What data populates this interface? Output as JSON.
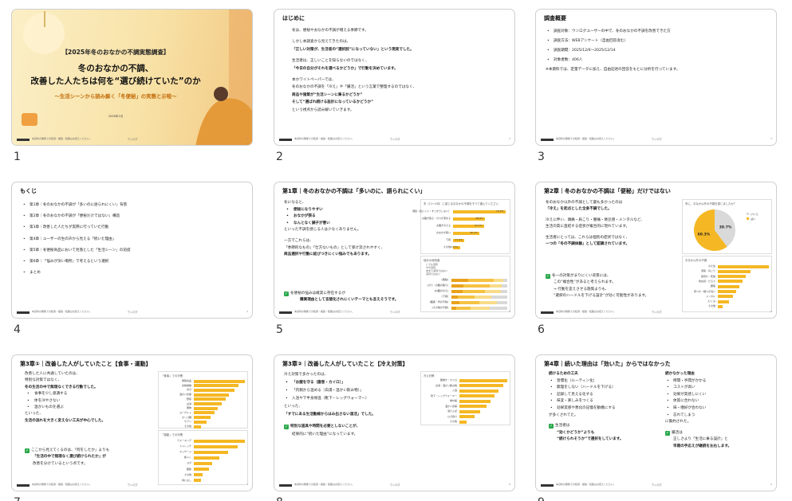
{
  "page_numbers": [
    "1",
    "2",
    "3",
    "4",
    "5",
    "6",
    "7",
    "8",
    "9"
  ],
  "footer": {
    "text": "本資料の無断での転用・複製・転載はお控えください。",
    "brand": "ウンログ",
    "page_nums": [
      "1",
      "2",
      "3",
      "4",
      "5",
      "6",
      "7",
      "8",
      "9"
    ]
  },
  "colors": {
    "accent": "#f5b824",
    "grey": "#d9d9d9",
    "green": "#2aa84a"
  },
  "slide1": {
    "tag": "【2025年冬のおなかの不調実態調査】",
    "title_line1": "冬のおなかの不調、",
    "title_line2": "改善した人たちは何を“選び続けていた”のか",
    "subtitle": "〜生活シーンから読み解く「冬便秘」の実態と示唆〜",
    "date": "2026年1月"
  },
  "slide2": {
    "title": "はじめに",
    "lines": [
      {
        "t": "冬は、便秘やおなかの不調が増える季節です。",
        "b": false
      },
      {
        "t": "",
        "b": false
      },
      {
        "t": "しかし本調査から見えてきたのは、",
        "b": false
      },
      {
        "t": "「正しい対策が、生活者の“選択肢”になっていない」という現実でした。",
        "b": true
      },
      {
        "t": "",
        "b": false
      },
      {
        "t": "生活者は、正しいことを知らないのではなく、",
        "b": false
      },
      {
        "t": "「今日の自分がそれを選べるかどうか」で行動を決めています。",
        "b": true
      },
      {
        "t": "",
        "b": false
      },
      {
        "t": "本ホワイトペーパーでは、",
        "b": false
      },
      {
        "t": "冬のおなかの不調を「冷え」や「腸活」という言葉で整理するのではなく、",
        "b": false
      },
      {
        "t": "商品や施策が“生活シーンに乗るかどうか”",
        "b": true
      },
      {
        "t": "そして“選ばれ続ける設計になっているかどうか”",
        "b": true
      },
      {
        "t": "という視点から読み解いていきます。",
        "b": false
      }
    ]
  },
  "slide3": {
    "title": "調査概要",
    "items": [
      "調査対象：ウンログユーザーの中で、冬のおなかの不調を改善できた方",
      "調査方法：WEBアンケート（自由回答含む）",
      "調査期間：2025/12/6〜2025/12/14",
      "対象者数：406人"
    ],
    "note": "※本資料では、定量データに加え、自由記述の回答をもとに分析を行っています。"
  },
  "slide4": {
    "title": "もくじ",
    "items": [
      "第1章｜冬のおなかの不調が「多いのに語られにくい」背景",
      "第2章｜冬のおなかの不調が「便秘だけではない」構造",
      "第3章｜改善した人たちが実際に行っていた行動",
      "第4章｜ユーザーの生の声から見える「続いた理由」",
      "第5章｜冬便秘商品において見落とした「生活シーン」の前提",
      "第6章｜「悩みが深い場所」で考えるという選択",
      "まとめ"
    ]
  },
  "slide5": {
    "title": "第1章｜冬のおなかの不調は「多いのに、語られにくい」",
    "lines": [
      {
        "t": "冬になると、",
        "b": false,
        "li": false
      },
      {
        "t": "便秘になりやすい",
        "b": true,
        "li": true
      },
      {
        "t": "おなかが張る",
        "b": true,
        "li": true
      },
      {
        "t": "なんとなく調子が悪い",
        "b": true,
        "li": true
      },
      {
        "t": "といった不調を感じる人は少なくありません。",
        "b": false,
        "li": false
      },
      {
        "t": "",
        "b": false,
        "li": false
      },
      {
        "t": "一方でこれらは、",
        "b": false,
        "li": false
      },
      {
        "t": "「季節的なもの」「仕方ないもの」として受け流されやすく、",
        "b": false,
        "li": false
      },
      {
        "t": "商品選択や行動に結びつきにくい悩みでもあります。",
        "b": true,
        "li": false
      }
    ],
    "callout_l1": "冬便秘の悩みは確実に存在するが",
    "callout_l2": "購買理由として言語化されにくいテーマとも言えそうです。"
  },
  "slide6": {
    "title": "第2章｜冬のおなかの不調は「便秘」だけではない",
    "lines": [
      {
        "t": "冬のおなか以外の不調として最も多かったのは",
        "b": false
      },
      {
        "t": "「冷え」を起点とした全身不調でした。",
        "b": true
      },
      {
        "t": "",
        "b": false
      },
      {
        "t": "冷えに伴い、頭痛・肩こり・腰痛・倦怠感・メンタルなど、",
        "b": false
      },
      {
        "t": "生活の質に直結する症状が複合的に現れています。",
        "b": false
      },
      {
        "t": "",
        "b": false
      },
      {
        "t": "生活者にとっては、これらは個別の症状ではなく、",
        "b": false
      },
      {
        "t": "一つの「冬の不調体験」として認識されています。",
        "b": true
      }
    ],
    "callout": [
      "冬一の対策がまりにくい背景には、",
      "この“複合性”があると考えられます。",
      "→ 行動を変えさせる施策よりも、",
      "“選択のハードルを下げる設計”が効く可能性があります。"
    ]
  },
  "slide7": {
    "title": "第3章①｜改善した人がしていたこと【食事・運動】",
    "lines": [
      {
        "t": "改善した人に共通していたのは、",
        "b": false,
        "li": false
      },
      {
        "t": "特別な対策ではなく、",
        "b": false,
        "li": false
      },
      {
        "t": "冬の生活の中で無理なくできる行動でした。",
        "b": true,
        "li": false
      },
      {
        "t": "食事を少し意識する",
        "b": false,
        "li": true
      },
      {
        "t": "体を冷やさない",
        "b": false,
        "li": true
      },
      {
        "t": "温かいものを選ぶ",
        "b": false,
        "li": true
      },
      {
        "t": "といった、",
        "b": false,
        "li": false
      },
      {
        "t": "生活の流れを大きく変えない工夫が中心でした。",
        "b": true,
        "li": false
      }
    ],
    "callout": [
      "ここから見えてくるのは、「何をしたか」よりも",
      "「生活の中で無理なく選び続けられたか」が",
      "改善を分けているという点です。"
    ]
  },
  "slide8": {
    "title": "第3章②｜改善した人がしていたこと【冷え対策】",
    "lead": "冷え対策で多かったのは、",
    "items": [
      "「お腹を守る（腹巻・カイロ）」",
      "「内側から温める（白湯・温かい飲み物）」",
      "入浴や下半身保温（靴下・レッグウォーマー）"
    ],
    "after": "といった、",
    "bold": "「すでにある生活動線からはみ出さない温活」でした。",
    "callout": [
      "特別な道具や時間を必要としないことが、",
      "結果的に“続いた理由”になっています。"
    ]
  },
  "slide9": {
    "title": "第4章｜続いた理由は「効いた」からではなかった",
    "left_head": "続けるための工夫",
    "left_items": [
      "習慣化（ルーティン化）",
      "無理をしない（ハードルを下げる）",
      "記録して見える化する",
      "味変・楽しみをつくる",
      "効果実感や悪化の記憶を動機にする"
    ],
    "left_after": "が多くされてた。",
    "right_head": "続かなかった理由",
    "right_items": [
      "時間・手間がかかる",
      "コストが高い",
      "効果が実感しにくい",
      "体質に合わない",
      "味・嗜好が合わない",
      "忘れてしまう"
    ],
    "right_after": "に集約された。",
    "callout_left": [
      "生活者は",
      "“効くかどうか”よりも",
      "“続けられそうか”で選択をしています。"
    ],
    "callout_right": [
      "腸活は",
      "正しさより「生活に乗る設計」と",
      "早期の手応えが継続を左右します。"
    ]
  },
  "chart_data": [
    {
      "type": "bar",
      "title": "冬（11〜2月）に感じるおなかの不調をすべて選んでください",
      "categories": [
        "便秘（出にくい・すっきりしない）",
        "お腹が張る・ガスが溜まる",
        "お腹が冷える",
        "おなかが痛い",
        "下痢",
        "その他"
      ],
      "values": [
        79.5,
        48.6,
        47.1,
        40.1,
        17.4,
        10.5
      ]
    },
    {
      "type": "bar",
      "title": "悩みの深刻度",
      "categories": [
        "[便秘]",
        "[ガス・お腹の張り]",
        "[お腹の冷え]",
        "[下痢]",
        "[腹痛・胃の不快]",
        "[その他の不調]"
      ],
      "series": [
        {
          "name": "とても深刻",
          "values": [
            30,
            22,
            20,
            12,
            14,
            8
          ]
        },
        {
          "name": "やや深刻",
          "values": [
            45,
            46,
            40,
            30,
            36,
            26
          ]
        },
        {
          "name": "あまり深刻ではない",
          "values": [
            18,
            22,
            28,
            30,
            32,
            34
          ]
        },
        {
          "name": "深刻ではない",
          "values": [
            7,
            10,
            12,
            28,
            18,
            32
          ]
        }
      ]
    },
    {
      "type": "pie",
      "title": "冬に、おなか以外の不調を感じましたか？",
      "categories": [
        "いいえ",
        "はい"
      ],
      "values": [
        39.7,
        60.3
      ]
    },
    {
      "type": "bar",
      "title": "おなか以外の不調",
      "categories": [
        "冷え性",
        "頭痛・肩こり",
        "肌荒れ・乾燥",
        "倦怠感・だるさ",
        "腰痛",
        "寝つき・眠りが浅い",
        "メンタル",
        "むくみ",
        "その他"
      ],
      "values": [
        62,
        40,
        34,
        30,
        26,
        22,
        18,
        14,
        6
      ]
    },
    {
      "type": "bar",
      "title": "「食事」での対策",
      "categories": [
        "発酵食品",
        "食物繊維",
        "水分",
        "温かい食事",
        "野菜",
        "白湯",
        "果物",
        "ヨーグルト",
        "オリゴ糖",
        "サプリ",
        "その他"
      ],
      "values": [
        55,
        48,
        44,
        38,
        34,
        30,
        26,
        22,
        18,
        14,
        8
      ]
    },
    {
      "type": "bar",
      "title": "「運動」での対策",
      "categories": [
        "ウォーキング",
        "ストレッチ",
        "マッサージ",
        "筋トレ",
        "ヨガ",
        "腹筋",
        "その他",
        "特になし"
      ],
      "values": [
        60,
        52,
        40,
        30,
        22,
        18,
        10,
        8
      ]
    },
    {
      "type": "bar",
      "title": "冷え対策",
      "categories": [
        "腹巻き・カイロ",
        "白湯・温かい飲み物",
        "入浴",
        "靴下・レッグウォーマー",
        "重ね着",
        "温かい食事",
        "湯たんぽ",
        "ひざ掛け",
        "その他"
      ],
      "values": [
        68,
        62,
        56,
        50,
        44,
        38,
        30,
        22,
        10
      ]
    }
  ]
}
